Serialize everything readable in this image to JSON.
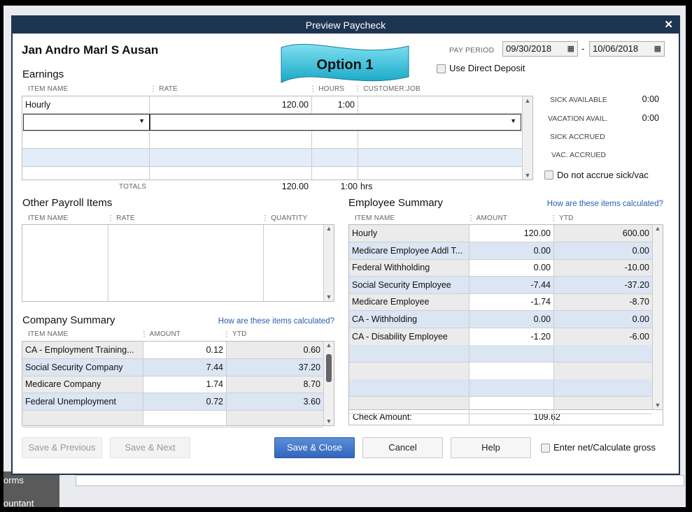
{
  "window": {
    "title": "Preview Paycheck"
  },
  "employee_name": "Jan Andro Marl S Ausan",
  "banner": "Option 1",
  "pay_period": {
    "label": "PAY PERIOD",
    "start": "09/30/2018",
    "end": "10/06/2018",
    "sep": "-"
  },
  "direct_deposit": {
    "label": "Use Direct Deposit",
    "checked": false
  },
  "earnings": {
    "title": "Earnings",
    "headers": [
      "ITEM NAME",
      "RATE",
      "HOURS",
      "CUSTOMER:JOB"
    ],
    "rows": [
      {
        "item": "Hourly",
        "rate": "120.00",
        "hours": "1:00",
        "job": ""
      }
    ],
    "totals": {
      "label": "TOTALS",
      "rate": "120.00",
      "hours": "1:00",
      "unit": "hrs"
    }
  },
  "sick": {
    "items": [
      {
        "label": "SICK AVAILABLE",
        "value": "0:00"
      },
      {
        "label": "VACATION AVAIL.",
        "value": "0:00"
      },
      {
        "label": "SICK ACCRUED",
        "value": ""
      },
      {
        "label": "VAC. ACCRUED",
        "value": ""
      }
    ],
    "no_accrue_label": "Do not accrue sick/vac"
  },
  "other_payroll": {
    "title": "Other Payroll Items",
    "headers": [
      "ITEM NAME",
      "RATE",
      "QUANTITY"
    ]
  },
  "company_summary": {
    "title": "Company Summary",
    "link": "How are these items calculated?",
    "headers": [
      "ITEM NAME",
      "AMOUNT",
      "YTD"
    ],
    "rows": [
      {
        "item": "CA - Employment Training...",
        "amount": "0.12",
        "ytd": "0.60"
      },
      {
        "item": "Social Security Company",
        "amount": "7.44",
        "ytd": "37.20"
      },
      {
        "item": "Medicare Company",
        "amount": "1.74",
        "ytd": "8.70"
      },
      {
        "item": "Federal Unemployment",
        "amount": "0.72",
        "ytd": "3.60"
      }
    ]
  },
  "employee_summary": {
    "title": "Employee Summary",
    "link": "How are these items calculated?",
    "headers": [
      "ITEM NAME",
      "AMOUNT",
      "YTD"
    ],
    "rows": [
      {
        "item": "Hourly",
        "amount": "120.00",
        "ytd": "600.00"
      },
      {
        "item": "Medicare Employee Addl T...",
        "amount": "0.00",
        "ytd": "0.00"
      },
      {
        "item": "Federal Withholding",
        "amount": "0.00",
        "ytd": "-10.00"
      },
      {
        "item": "Social Security Employee",
        "amount": "-7.44",
        "ytd": "-37.20"
      },
      {
        "item": "Medicare Employee",
        "amount": "-1.74",
        "ytd": "-8.70"
      },
      {
        "item": "CA - Withholding",
        "amount": "0.00",
        "ytd": "0.00"
      },
      {
        "item": "CA - Disability Employee",
        "amount": "-1.20",
        "ytd": "-6.00"
      }
    ],
    "check_amount_label": "Check Amount:",
    "check_amount": "109.62"
  },
  "buttons": {
    "save_previous": "Save & Previous",
    "save_next": "Save & Next",
    "save_close": "Save & Close",
    "cancel": "Cancel",
    "help": "Help"
  },
  "net_gross": {
    "label": "Enter net/Calculate gross",
    "checked": false
  },
  "background": {
    "nav1": "orms",
    "nav2": "ountant"
  }
}
